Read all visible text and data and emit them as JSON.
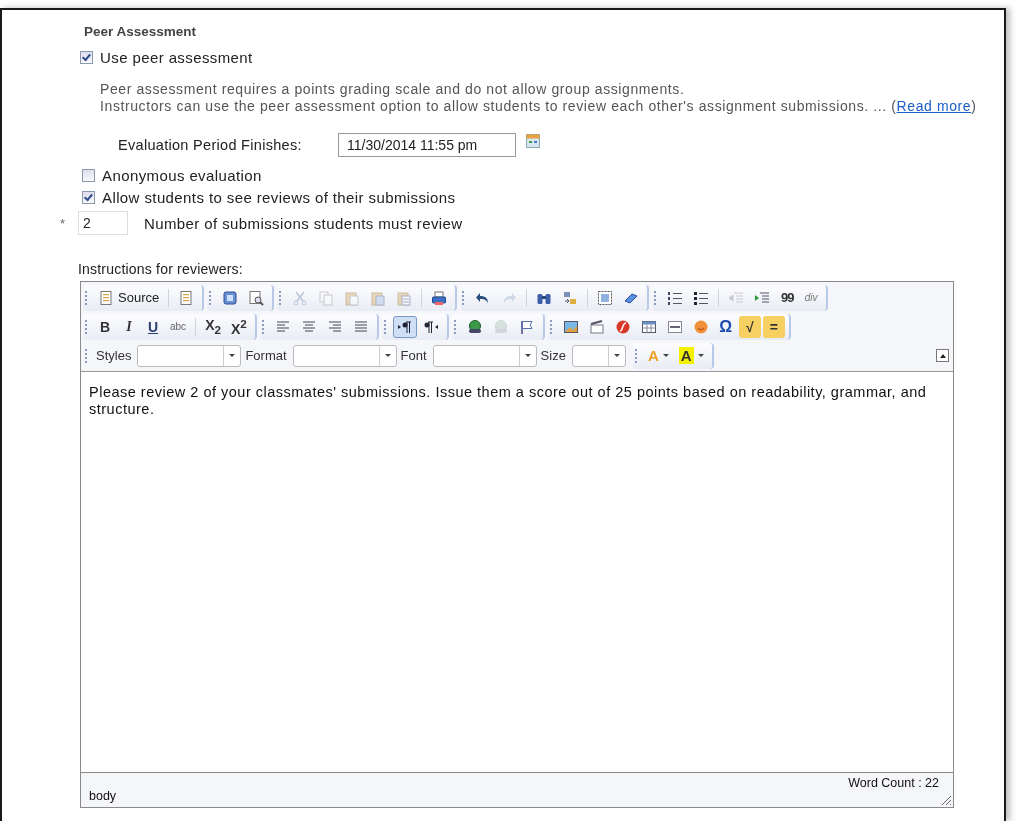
{
  "section_title": "Peer Assessment",
  "use_peer": {
    "label": "Use peer assessment",
    "checked": true
  },
  "description": {
    "line_1": "Peer assessment requires a points grading scale and do not allow group assignments.",
    "line_2": "Instructors can use the peer assessment option to allow students to review each other's assignment submissions. ... (",
    "link": "Read more",
    "line_2_end": ")"
  },
  "evaluation": {
    "label": "Evaluation Period Finishes:",
    "value": "11/30/2014 11:55 pm"
  },
  "options": [
    {
      "label": "Anonymous evaluation",
      "checked": false
    },
    {
      "label": "Allow students to see reviews of their submissions",
      "checked": true
    }
  ],
  "review_count": {
    "required_mark": "*",
    "value": "2",
    "label": "Number of submissions students must review"
  },
  "editor": {
    "label": "Instructions for reviewers:",
    "toolbar": [
      [
        [
          {
            "kind": "button",
            "label": "Source"
          },
          {
            "kind": "separator"
          },
          {
            "kind": "icon",
            "disabled": false
          }
        ],
        [
          {
            "kind": "icon",
            "disabled": false
          },
          {
            "kind": "icon",
            "disabled": false
          }
        ],
        [
          {
            "kind": "icon",
            "disabled": true
          },
          {
            "kind": "icon",
            "disabled": true
          },
          {
            "kind": "icon",
            "disabled": true
          },
          {
            "kind": "icon",
            "disabled": true
          },
          {
            "kind": "icon",
            "disabled": true
          },
          {
            "kind": "separator"
          },
          {
            "kind": "icon",
            "disabled": false
          }
        ],
        [
          {
            "kind": "icon",
            "disabled": false
          },
          {
            "kind": "icon",
            "disabled": true
          },
          {
            "kind": "separator"
          },
          {
            "kind": "icon",
            "disabled": false
          },
          {
            "kind": "icon",
            "disabled": false
          },
          {
            "kind": "separator"
          },
          {
            "kind": "icon",
            "disabled": false
          },
          {
            "kind": "icon",
            "disabled": false
          }
        ],
        [
          {
            "kind": "icon",
            "disabled": false
          },
          {
            "kind": "icon",
            "disabled": false
          },
          {
            "kind": "separator"
          },
          {
            "kind": "icon",
            "disabled": true
          },
          {
            "kind": "icon",
            "disabled": false
          },
          {
            "kind": "glyph",
            "text": "99"
          },
          {
            "kind": "glyph",
            "text": "div"
          }
        ]
      ],
      [
        [
          {
            "kind": "glyph",
            "text": "B"
          },
          {
            "kind": "glyph",
            "text": "I"
          },
          {
            "kind": "glyph",
            "text": "U"
          },
          {
            "kind": "glyph",
            "text": "abc"
          },
          {
            "kind": "separator"
          },
          {
            "kind": "glyph",
            "text": "X$_{2}$"
          },
          {
            "kind": "glyph",
            "text": "X$^{2}$"
          }
        ],
        [
          {
            "kind": "icon",
            "disabled": false
          },
          {
            "kind": "icon",
            "disabled": false
          },
          {
            "kind": "icon",
            "disabled": false
          },
          {
            "kind": "icon",
            "disabled": false
          }
        ],
        [
          {
            "kind": "icon",
            "disabled": false,
            "active": true
          },
          {
            "kind": "icon",
            "disabled": false,
            "active": false
          }
        ],
        [
          {
            "kind": "icon",
            "disabled": false
          },
          {
            "kind": "icon",
            "disabled": true
          },
          {
            "kind": "icon",
            "disabled": false
          }
        ],
        [
          {
            "kind": "icon",
            "disabled": false
          },
          {
            "kind": "icon",
            "disabled": false
          },
          {
            "kind": "icon",
            "disabled": false
          },
          {
            "kind": "icon",
            "disabled": false
          },
          {
            "kind": "icon",
            "disabled": false
          },
          {
            "kind": "icon",
            "disabled": false
          },
          {
            "kind": "glyph",
            "text": "Ω"
          },
          {
            "kind": "tile",
            "text": "√"
          },
          {
            "kind": "tile",
            "text": "="
          }
        ]
      ],
      [
        [
          {
            "kind": "combo",
            "label": "Styles"
          },
          {
            "kind": "combo",
            "label": "Format"
          },
          {
            "kind": "combo",
            "label": "Font"
          },
          {
            "kind": "combo",
            "label": "Size"
          }
        ],
        [
          {
            "kind": "textcolor",
            "text": "A",
            "color": "#f0a020"
          },
          {
            "kind": "bgcolor",
            "text": "A",
            "color": "#f4f000"
          }
        ]
      ]
    ],
    "content": "Please review 2 of your classmates' submissions.  Issue them a score out of 25 points based on readability, grammar, and structure.",
    "path": "body",
    "word_count": "Word Count : 22"
  }
}
